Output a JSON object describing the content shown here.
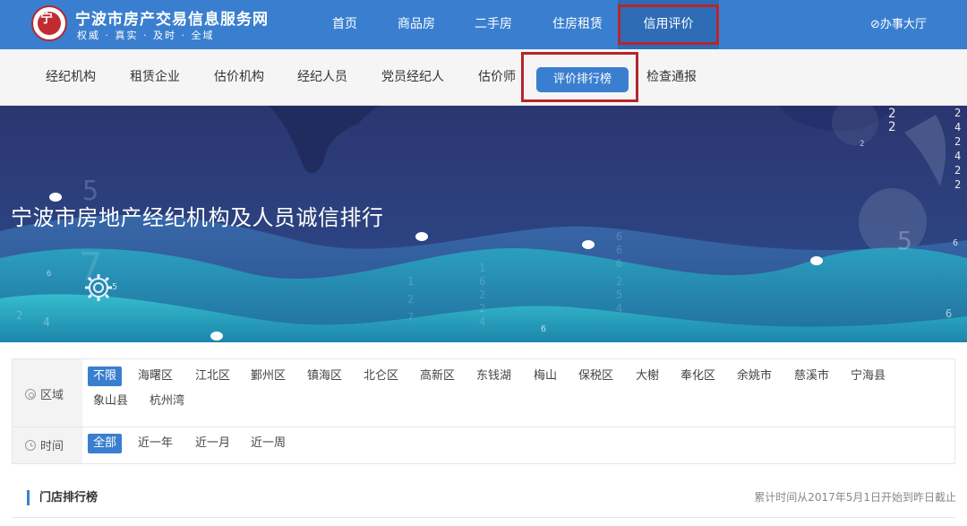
{
  "site": {
    "title": "宁波市房产交易信息服务网",
    "slogan": "权威 · 真实 · 及时 · 全域",
    "logo_mark": "宁"
  },
  "topnav": {
    "items": [
      {
        "label": "首页"
      },
      {
        "label": "商品房"
      },
      {
        "label": "二手房"
      },
      {
        "label": "住房租赁"
      },
      {
        "label": "信用评价",
        "active": true
      }
    ],
    "service_hall": "⊘办事大厅"
  },
  "subnav": {
    "items": [
      {
        "label": "经纪机构"
      },
      {
        "label": "租赁企业"
      },
      {
        "label": "估价机构"
      },
      {
        "label": "经纪人员"
      },
      {
        "label": "党员经纪人"
      },
      {
        "label": "估价师"
      },
      {
        "label": "评价排行榜",
        "active": true
      },
      {
        "label": "检查通报"
      }
    ]
  },
  "banner": {
    "title": "宁波市房地产经纪机构及人员诚信排行",
    "background_color": "#2b3f7a",
    "accent_color": "#2fb5c8"
  },
  "filters": {
    "region": {
      "label": "区域",
      "options": [
        "不限",
        "海曙区",
        "江北区",
        "鄞州区",
        "镇海区",
        "北仑区",
        "高新区",
        "东钱湖",
        "梅山",
        "保税区",
        "大榭",
        "奉化区",
        "余姚市",
        "慈溪市",
        "宁海县",
        "象山县",
        "杭州湾"
      ],
      "selected": "不限"
    },
    "time": {
      "label": "时间",
      "options": [
        "全部",
        "近一年",
        "近一月",
        "近一周"
      ],
      "selected": "全部"
    }
  },
  "section": {
    "title": "门店排行榜",
    "note": "累计时间从2017年5月1日开始到昨日截止"
  },
  "colors": {
    "primary": "#3a7fcf",
    "highlight_border": "#b8252b"
  }
}
